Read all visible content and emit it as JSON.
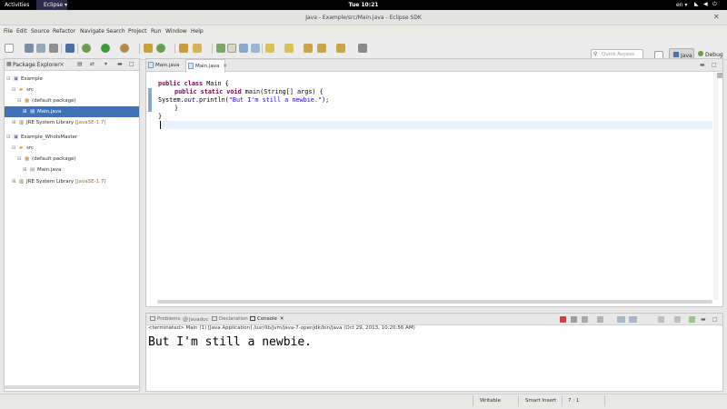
{
  "topbar": {
    "activities": "Activities",
    "app_menu": "Eclipse ▾",
    "clock": "Tue 10:21",
    "lang": "en ▾"
  },
  "window": {
    "title": "Java - Example/src/Main.java - Eclipse SDK"
  },
  "menu": [
    "File",
    "Edit",
    "Source",
    "Refactor",
    "Navigate",
    "Search",
    "Project",
    "Run",
    "Window",
    "Help"
  ],
  "toolbar": {
    "quick_access_placeholder": "Quick Access",
    "perspective_java": "Java",
    "perspective_debug": "Debug"
  },
  "package_explorer": {
    "title": "Package Explorer",
    "tree": [
      {
        "label": "Example",
        "suffix": ""
      },
      {
        "label": "src",
        "suffix": ""
      },
      {
        "label": "(default package)",
        "suffix": ""
      },
      {
        "label": "Main.java",
        "suffix": ""
      },
      {
        "label": "JRE System Library ",
        "suffix": "[JavaSE-1.7]"
      },
      {
        "label": "Example_WhoIsMaster",
        "suffix": ""
      },
      {
        "label": "src",
        "suffix": ""
      },
      {
        "label": "(default package)",
        "suffix": ""
      },
      {
        "label": "Main.java",
        "suffix": ""
      },
      {
        "label": "JRE System Library ",
        "suffix": "[JavaSE-1.7]"
      }
    ]
  },
  "editor": {
    "tabs": [
      "Main.java",
      "Main.java"
    ],
    "code": {
      "l1_kw": "public class",
      "l1_rest": " Main {",
      "l2_kw": "public static void",
      "l2_rest": " main(String[] args) {",
      "l3_a": "System.",
      "l3_out": "out",
      "l3_b": ".println(",
      "l3_str": "\"But I'm still a newbie.\"",
      "l3_c": ");",
      "l4": "}",
      "l5": "}"
    }
  },
  "console": {
    "tabs": [
      "Problems",
      "Javadoc",
      "Declaration",
      "Console"
    ],
    "terminated": "<terminated> Main (1) [Java Application] /usr/lib/jvm/java-7-openjdk/bin/java (Oct 29, 2013, 10:20:56 AM)",
    "output": "But I'm still a newbie."
  },
  "statusbar": {
    "writable": "Writable",
    "insert_mode": "Smart Insert",
    "position": "7 : 1"
  }
}
